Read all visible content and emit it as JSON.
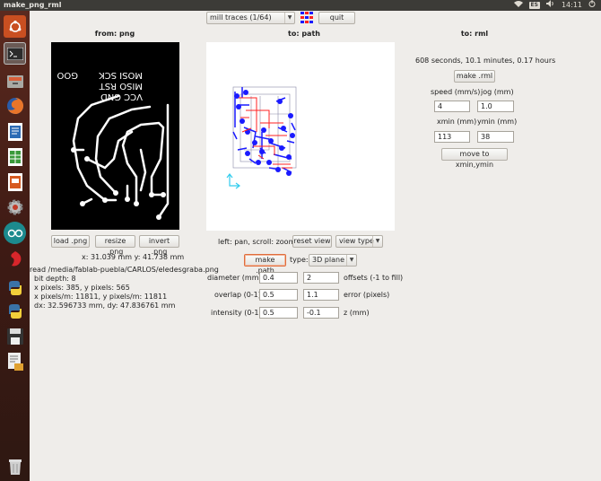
{
  "window": {
    "title": "make_png_rml",
    "tray_keyboard": "ES",
    "time": "14:11"
  },
  "launcher": {
    "items": [
      "ubuntu-dash",
      "terminal",
      "files",
      "firefox",
      "writer",
      "calc",
      "impress",
      "settings",
      "arduino",
      "app-red",
      "python",
      "python2",
      "save",
      "gedit-scripts",
      "trash"
    ]
  },
  "toolbar": {
    "mode_select": "mill traces (1/64)",
    "quit_label": "quit"
  },
  "left_panel": {
    "header": "from: png",
    "pcb_text_line1": "VCC GND",
    "pcb_text_line2": "MISO RST",
    "pcb_text_line3": "MOSI SCK",
    "pcb_text_side": "GOO",
    "load_label": "load .png",
    "resize_label": "resize .png",
    "invert_label": "invert .png",
    "coords": "x: 31.039 mm  y: 41.738 mm",
    "info": [
      "read /media/fablab-puebla/CARLOS/eledesgraba.png",
      "  bit depth: 8",
      "  x pixels: 385, y pixels: 565",
      "  x pixels/m: 11811, y pixels/m: 11811",
      "  dx: 32.596733 mm, dy: 47.836761 mm"
    ]
  },
  "center_panel": {
    "header": "to: path",
    "nav_hint": "left: pan, scroll: zoom",
    "reset_view_label": "reset view",
    "view_type_select": "view type",
    "make_path_label": "make .path",
    "type_label": "type:",
    "type_select": "3D plane",
    "params": {
      "diameter_label": "diameter (mm)",
      "diameter_value": "0.4",
      "offsets_value": "2",
      "offsets_label": "offsets (-1 to fill)",
      "overlap_label": "overlap (0-1)",
      "overlap_value": "0.5",
      "error_value": "1.1",
      "error_label": "error (pixels)",
      "intensity_label": "intensity (0-1)",
      "intensity_value": "0.5",
      "z_value": "-0.1",
      "z_label": "z (mm)"
    }
  },
  "right_panel": {
    "header": "to: rml",
    "estimate": "608 seconds, 10.1 minutes, 0.17 hours",
    "make_rml_label": "make .rml",
    "speed_label": "speed (mm/s)",
    "jog_label": "jog (mm)",
    "speed_value": "4",
    "jog_value": "1.0",
    "xmin_label": "xmin (mm)",
    "ymin_label": "ymin (mm)",
    "xmin_value": "113",
    "ymin_value": "38",
    "move_label": "move to xmin,ymin"
  },
  "colors": {
    "topbar": "#3c3b37",
    "launcher": "#4a2219",
    "active_accent": "#e06d3c",
    "path_blue": "#1a1aff",
    "path_red": "#ff2020"
  }
}
